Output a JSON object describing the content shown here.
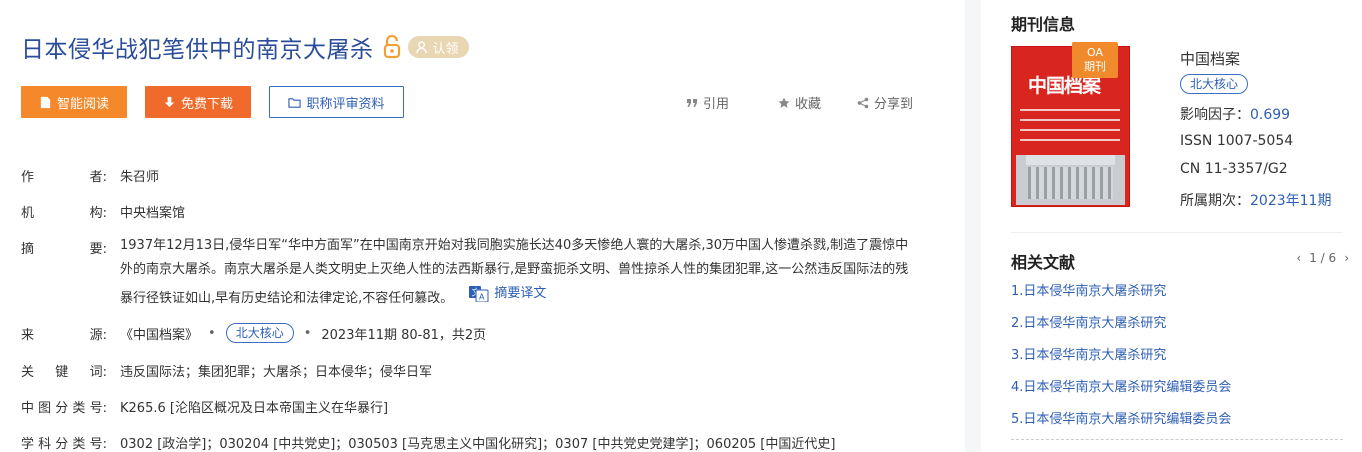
{
  "article": {
    "title": "日本侵华战犯笔供中的南京大屠杀",
    "claim_label": "认领"
  },
  "buttons": {
    "read": "智能阅读",
    "download": "免费下载",
    "title_material": "职称评审资料"
  },
  "actions": {
    "cite": "引用",
    "favorite": "收藏",
    "share": "分享到"
  },
  "meta": {
    "author_label": [
      "作",
      "者:"
    ],
    "author": "朱召师",
    "org_label": [
      "机",
      "构:"
    ],
    "org": "中央档案馆",
    "abstract_label": [
      "摘",
      "要:"
    ],
    "abstract": "1937年12月13日,侵华日军“华中方面军”在中国南京开始对我同胞实施长达40多天惨绝人寰的大屠杀,30万中国人惨遭杀戮,制造了震惊中外的南京大屠杀。南京大屠杀是人类文明史上灭绝人性的法西斯暴行,是野蛮扼杀文明、兽性掠杀人性的集团犯罪,这一公然违反国际法的残暴行径铁证如山,早有历史结论和法律定论,不容任何篡改。",
    "abstract_translate": "摘要译文",
    "source_label": [
      "来",
      "源:"
    ],
    "source_journal": "《中国档案》",
    "source_core": "北大核心",
    "source_issue": "2023年11期 80-81，共2页",
    "keywords_label": [
      "关",
      "键",
      "词:"
    ],
    "keywords": "违反国际法；集团犯罪；大屠杀；日本侵华；侵华日军",
    "clc_label": [
      "中",
      "图",
      "分",
      "类",
      "号:"
    ],
    "clc": "K265.6 [沦陷区概况及日本帝国主义在华暴行]",
    "subject_label": [
      "学",
      "科",
      "分",
      "类",
      "号:"
    ],
    "subject": "0302 [政治学]；030204 [中共党史]；030503 [马克思主义中国化研究]；0307 [中共党史党建学]；060205 [中国近代史]"
  },
  "journal": {
    "heading": "期刊信息",
    "oa_badge": [
      "OA",
      "期刊"
    ],
    "cover_text": "中国档案",
    "name": "中国档案",
    "core": "北大核心",
    "impact_label": "影响因子：",
    "impact": "0.699",
    "issn": "ISSN 1007-5054",
    "cn": "CN 11-3357/G2",
    "issue_label": "所属期次：",
    "issue": "2023年11期"
  },
  "related": {
    "heading": "相关文献",
    "pager": "1 / 6",
    "items": [
      "1.日本侵华南京大屠杀研究",
      "2.日本侵华南京大屠杀研究",
      "3.日本侵华南京大屠杀研究",
      "4.日本侵华南京大屠杀研究编辑委员会",
      "5.日本侵华南京大屠杀研究编辑委员会"
    ]
  },
  "colors": {
    "title_blue": "#2b4c9a",
    "link_blue": "#2e5fb5",
    "read_orange": "#f4882b",
    "download_orange": "#f06a2b",
    "oa_orange": "#f08a2c",
    "cover_red": "#d8251f"
  },
  "icons": [
    "open-lock-icon",
    "user-claim-icon",
    "document-icon",
    "download-arrow-icon",
    "folder-icon",
    "quote-icon",
    "star-icon",
    "share-icon",
    "translate-icon",
    "chevron-left-icon",
    "chevron-right-icon"
  ]
}
